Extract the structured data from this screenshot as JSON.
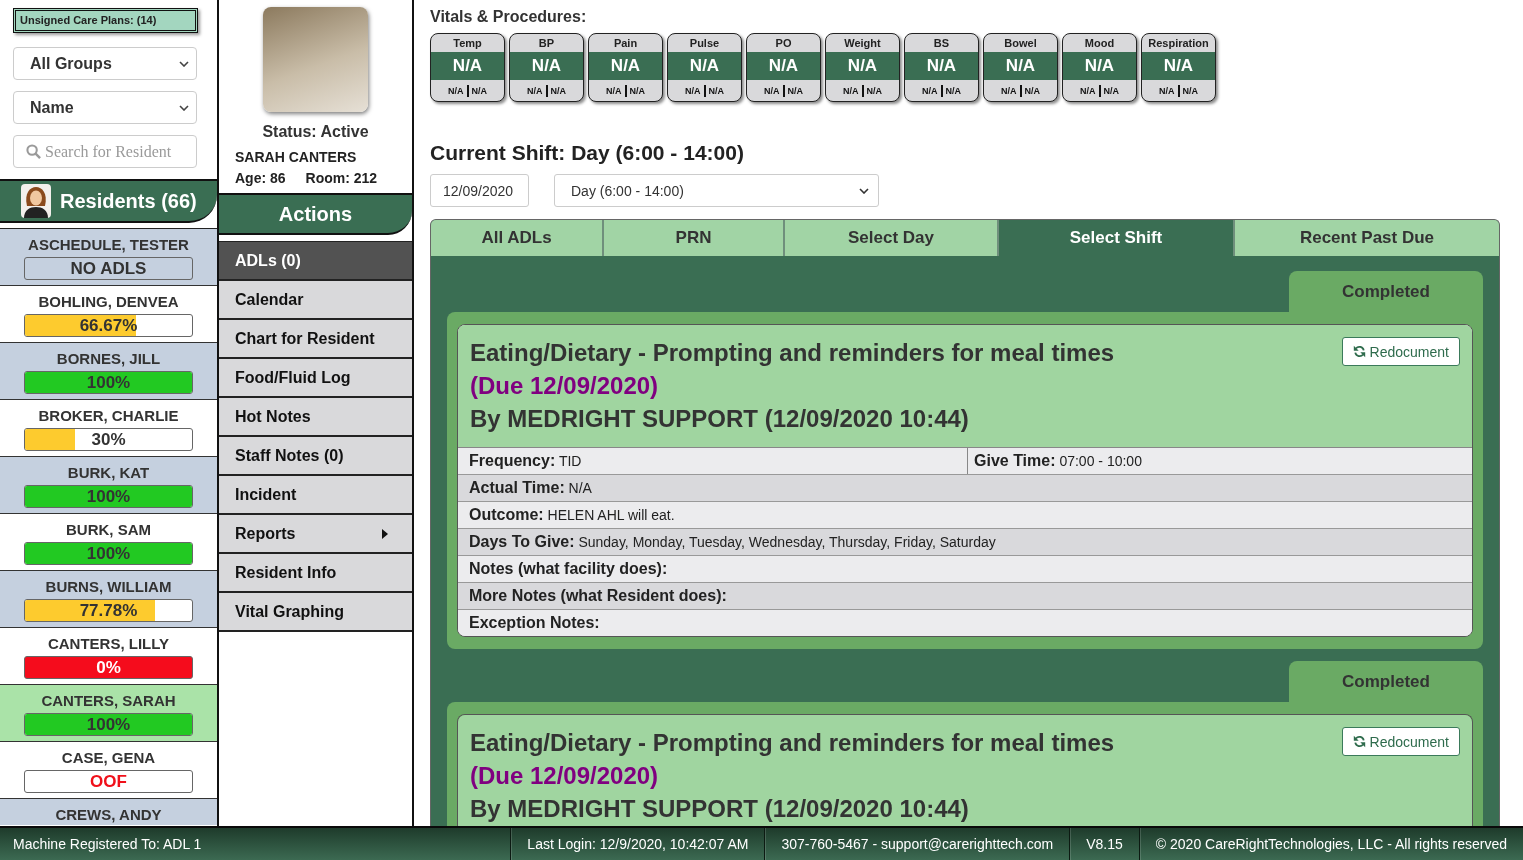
{
  "sidebar": {
    "unsigned_care_plans": "Unsigned Care Plans: (14)",
    "group_filter": "All Groups",
    "sort_by": "Name",
    "search": {
      "placeholder": "Search for Resident"
    },
    "residents_title": "Residents (66)",
    "residents": [
      {
        "name": "ASCHEDULE, TESTER",
        "selected": false,
        "kind": "empty",
        "status": "NO ADLS"
      },
      {
        "name": "BOHLING, DENVEA",
        "selected": false,
        "kind": "progress",
        "level": 0.6667,
        "reading": "66.67%"
      },
      {
        "name": "BORNES, JILL",
        "selected": false,
        "kind": "progress",
        "level": 1,
        "reading": "100%"
      },
      {
        "name": "BROKER, CHARLIE",
        "selected": false,
        "kind": "progress",
        "level": 0.3,
        "reading": "30%"
      },
      {
        "name": "BURK, KAT",
        "selected": false,
        "kind": "progress",
        "level": 1,
        "reading": "100%"
      },
      {
        "name": "BURK, SAM",
        "selected": false,
        "kind": "progress",
        "level": 1,
        "reading": "100%"
      },
      {
        "name": "BURNS, WILLIAM",
        "selected": false,
        "kind": "progress",
        "level": 0.7778,
        "reading": "77.78%"
      },
      {
        "name": "CANTERS, LILLY",
        "selected": false,
        "kind": "alert",
        "status": "0%"
      },
      {
        "name": "CANTERS, SARAH",
        "selected": true,
        "kind": "progress",
        "level": 1,
        "reading": "100%"
      },
      {
        "name": "CASE, GENA",
        "selected": false,
        "kind": "away",
        "status": "OOF"
      },
      {
        "name": "CREWS, ANDY",
        "selected": false
      }
    ]
  },
  "profile": {
    "status": "Status: Active",
    "name": "SARAH CANTERS",
    "age": "Age: 86",
    "room": "Room: 212"
  },
  "actions": {
    "title": "Actions",
    "items": [
      {
        "label": "ADLs (0)",
        "selected": true,
        "submenu": false
      },
      {
        "label": "Calendar",
        "selected": false,
        "submenu": false
      },
      {
        "label": "Chart for Resident",
        "selected": false,
        "submenu": false
      },
      {
        "label": "Food/Fluid Log",
        "selected": false,
        "submenu": false
      },
      {
        "label": "Hot Notes",
        "selected": false,
        "submenu": false
      },
      {
        "label": "Staff Notes (0)",
        "selected": false,
        "submenu": false
      },
      {
        "label": "Incident",
        "selected": false,
        "submenu": false
      },
      {
        "label": "Reports",
        "selected": false,
        "submenu": true
      },
      {
        "label": "Resident Info",
        "selected": false,
        "submenu": false
      },
      {
        "label": "Vital Graphing",
        "selected": false,
        "submenu": false
      }
    ]
  },
  "vitals": {
    "title": "Vitals & Procedures:",
    "items": [
      {
        "label": "Temp",
        "value": "N/A",
        "readings": [
          "N/A",
          "N/A"
        ]
      },
      {
        "label": "BP",
        "value": "N/A",
        "readings": [
          "N/A",
          "N/A"
        ]
      },
      {
        "label": "Pain",
        "value": "N/A",
        "readings": [
          "N/A",
          "N/A"
        ]
      },
      {
        "label": "Pulse",
        "value": "N/A",
        "readings": [
          "N/A",
          "N/A"
        ]
      },
      {
        "label": "PO",
        "value": "N/A",
        "readings": [
          "N/A",
          "N/A"
        ]
      },
      {
        "label": "Weight",
        "value": "N/A",
        "readings": [
          "N/A",
          "N/A"
        ]
      },
      {
        "label": "BS",
        "value": "N/A",
        "readings": [
          "N/A",
          "N/A"
        ]
      },
      {
        "label": "Bowel",
        "value": "N/A",
        "readings": [
          "N/A",
          "N/A"
        ]
      },
      {
        "label": "Mood",
        "value": "N/A",
        "readings": [
          "N/A",
          "N/A"
        ]
      },
      {
        "label": "Respiration",
        "value": "N/A",
        "readings": [
          "N/A",
          "N/A"
        ]
      }
    ]
  },
  "shift": {
    "title": "Current Shift: Day (6:00 - 14:00)",
    "date": "12/09/2020",
    "shift": "Day (6:00 - 14:00)"
  },
  "tabs": [
    {
      "label": "All ADLs",
      "selected": false
    },
    {
      "label": "PRN",
      "selected": false
    },
    {
      "label": "Select Day",
      "selected": false
    },
    {
      "label": "Select Shift",
      "selected": true
    },
    {
      "label": "Recent Past Due",
      "selected": false
    }
  ],
  "records": [
    {
      "status": "Completed",
      "title": "Eating/Dietary - Prompting and reminders for meal times",
      "due": "(Due 12/09/2020)",
      "by": "By MEDRIGHT SUPPORT (12/09/2020 10:44)",
      "action": "Redocument",
      "fields": [
        [
          {
            "label": "Frequency:",
            "value": "TID"
          },
          {
            "label": "Give Time:",
            "value": "07:00 - 10:00"
          }
        ],
        [
          {
            "label": "Actual Time:",
            "value": "N/A"
          }
        ],
        [
          {
            "label": "Outcome:",
            "value": "HELEN AHL will eat."
          }
        ],
        [
          {
            "label": "Days To Give:",
            "value": "Sunday, Monday, Tuesday, Wednesday, Thursday, Friday, Saturday"
          }
        ],
        [
          {
            "label": "Notes (what facility does):"
          }
        ],
        [
          {
            "label": "More Notes (what Resident does):"
          }
        ],
        [
          {
            "label": "Exception Notes:"
          }
        ]
      ]
    },
    {
      "status": "Completed",
      "title": "Eating/Dietary - Prompting and reminders for meal times",
      "due": "(Due 12/09/2020)",
      "by": "By MEDRIGHT SUPPORT (12/09/2020 10:44)",
      "action": "Redocument"
    }
  ],
  "status_bar": [
    "Machine Registered To: ADL 1",
    "Last Login: 12/9/2020, 10:42:07 AM",
    "307-760-5467 - support@carerighttech.com",
    "V8.15",
    "© 2020 CareRightTechnologies, LLC - All rights reserved"
  ]
}
